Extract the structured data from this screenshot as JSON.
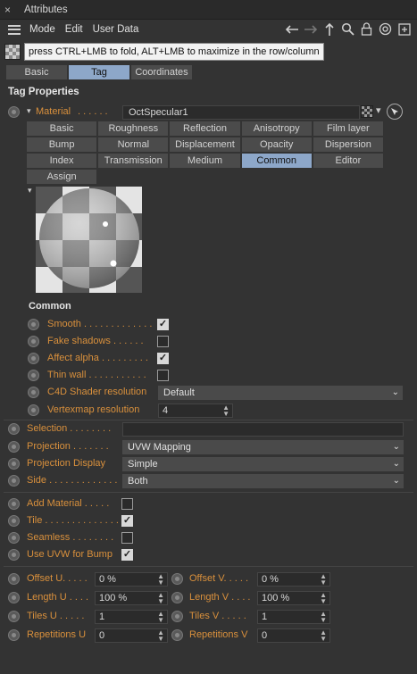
{
  "window": {
    "title": "Attributes",
    "close": "×"
  },
  "menu": [
    "Mode",
    "Edit",
    "User Data"
  ],
  "tooltip": "press CTRL+LMB to fold, ALT+LMB to maximize in the row/column",
  "tabs": [
    "Basic",
    "Tag",
    "Coordinates"
  ],
  "active_tab": "Tag",
  "section_title": "Tag Properties",
  "material": {
    "label": "Material",
    "value": "OctSpecular1"
  },
  "shader_tabs": [
    "Basic",
    "Roughness",
    "Reflection",
    "Anisotropy",
    "Film layer",
    "Bump",
    "Normal",
    "Displacement",
    "Opacity",
    "Dispersion",
    "Index",
    "Transmission",
    "Medium",
    "Common",
    "Editor",
    "Assign"
  ],
  "active_shader_tab": "Common",
  "common": {
    "title": "Common",
    "smooth": {
      "label": "Smooth . . . . . . . . . . . . .",
      "checked": true
    },
    "fake_shadows": {
      "label": "Fake shadows . . . . . .",
      "checked": false
    },
    "affect_alpha": {
      "label": "Affect alpha . . . . . . . . .",
      "checked": true
    },
    "thin_wall": {
      "label": "Thin wall . . . . . . . . . . .",
      "checked": false
    },
    "c4d_shader_res": {
      "label": "C4D Shader resolution",
      "value": "Default"
    },
    "vertexmap_res": {
      "label": "Vertexmap resolution",
      "value": "4"
    }
  },
  "tag": {
    "selection": {
      "label": "Selection . . . . . . . .",
      "value": ""
    },
    "projection": {
      "label": "Projection . . . . . . .",
      "value": "UVW Mapping"
    },
    "projection_display": {
      "label": "Projection Display",
      "value": "Simple"
    },
    "side": {
      "label": "Side . . . . . . . . . . . . .",
      "value": "Both"
    },
    "add_material": {
      "label": "Add Material . . . . .",
      "checked": false
    },
    "tile": {
      "label": "Tile . . . . . . . . . . . . . .",
      "checked": true
    },
    "seamless": {
      "label": "Seamless . . . . . . . .",
      "checked": false
    },
    "use_uvw_bump": {
      "label": "Use UVW for Bump",
      "checked": true
    }
  },
  "offsets": {
    "offset_u": {
      "label": "Offset U. . . . .",
      "value": "0 %"
    },
    "offset_v": {
      "label": "Offset V. . . . .",
      "value": "0 %"
    },
    "length_u": {
      "label": "Length U . . . .",
      "value": "100 %"
    },
    "length_v": {
      "label": "Length V . . . .",
      "value": "100 %"
    },
    "tiles_u": {
      "label": "Tiles U . . . . .",
      "value": "1"
    },
    "tiles_v": {
      "label": "Tiles V . . . . .",
      "value": "1"
    },
    "repetitions_u": {
      "label": "Repetitions U",
      "value": "0"
    },
    "repetitions_v": {
      "label": "Repetitions V",
      "value": "0"
    }
  },
  "colors": {
    "accent_label": "#d9903c",
    "active_tab": "#8da7c9",
    "background": "#333333"
  }
}
